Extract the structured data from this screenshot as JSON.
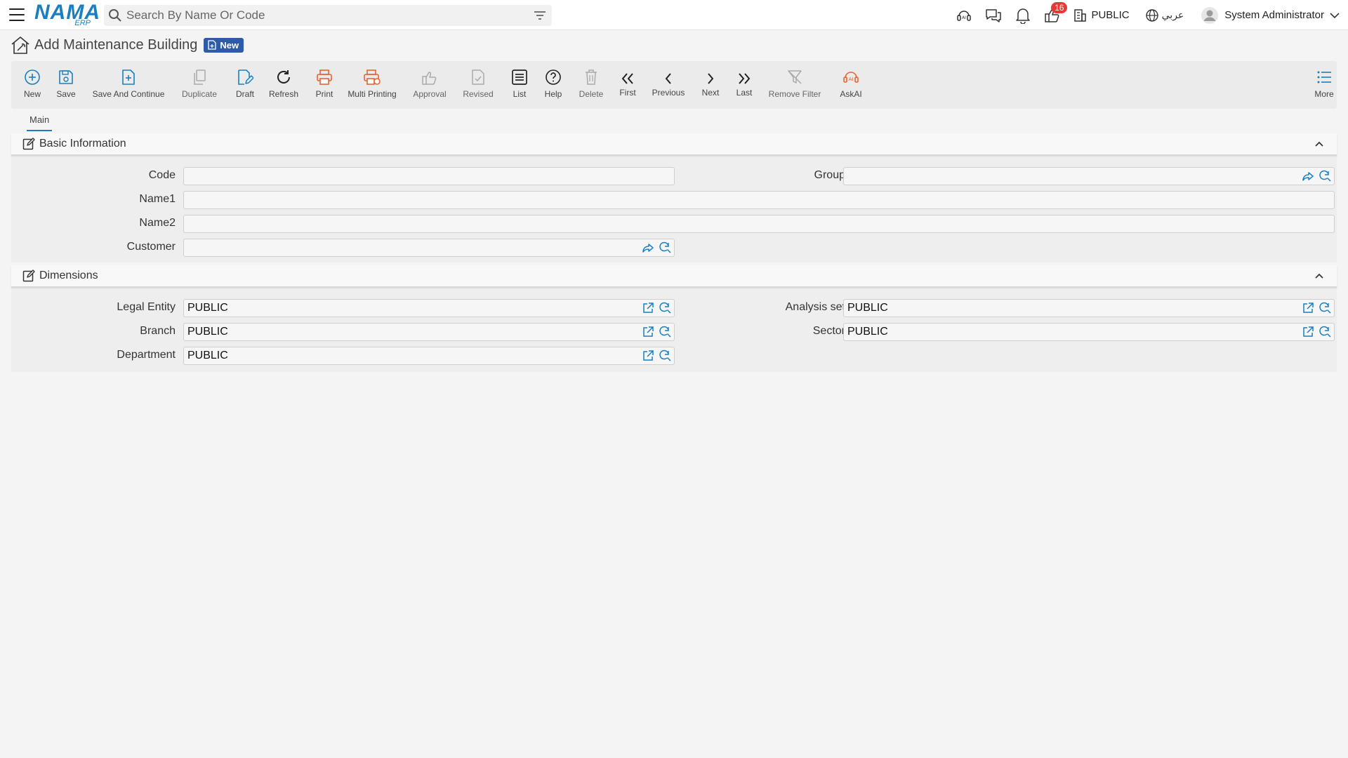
{
  "topbar": {
    "logo_text": "NAMA",
    "logo_sub": "ERP",
    "search_placeholder": "Search By Name Or Code",
    "notification_count": "16",
    "company": "PUBLIC",
    "language": "عربي",
    "user_name": "System Administrator"
  },
  "page": {
    "title": "Add Maintenance Building",
    "status_badge": "New"
  },
  "toolbar": {
    "new": "New",
    "save": "Save",
    "save_continue": "Save And Continue",
    "duplicate": "Duplicate",
    "draft": "Draft",
    "refresh": "Refresh",
    "print": "Print",
    "multi_printing": "Multi Printing",
    "approval": "Approval",
    "revised": "Revised",
    "list": "List",
    "help": "Help",
    "delete": "Delete",
    "first": "First",
    "previous": "Previous",
    "next": "Next",
    "last": "Last",
    "remove_filter": "Remove Filter",
    "askai": "AskAI",
    "more": "More"
  },
  "tabs": {
    "main": "Main"
  },
  "basic_info": {
    "title": "Basic Information",
    "code_label": "Code",
    "code_value": "",
    "group_label": "Group",
    "group_value": "",
    "name1_label": "Name1",
    "name1_value": "",
    "name2_label": "Name2",
    "name2_value": "",
    "customer_label": "Customer",
    "customer_value": ""
  },
  "dimensions": {
    "title": "Dimensions",
    "legal_entity_label": "Legal Entity",
    "legal_entity_value": "PUBLIC",
    "analysis_set_label": "Analysis set",
    "analysis_set_value": "PUBLIC",
    "branch_label": "Branch",
    "branch_value": "PUBLIC",
    "sector_label": "Sector",
    "sector_value": "PUBLIC",
    "department_label": "Department",
    "department_value": "PUBLIC"
  },
  "colors": {
    "accent_blue": "#1a7fc1",
    "print_orange": "#e8632b",
    "badge_red": "#e53935",
    "status_badge_bg": "#2d5ba8"
  }
}
